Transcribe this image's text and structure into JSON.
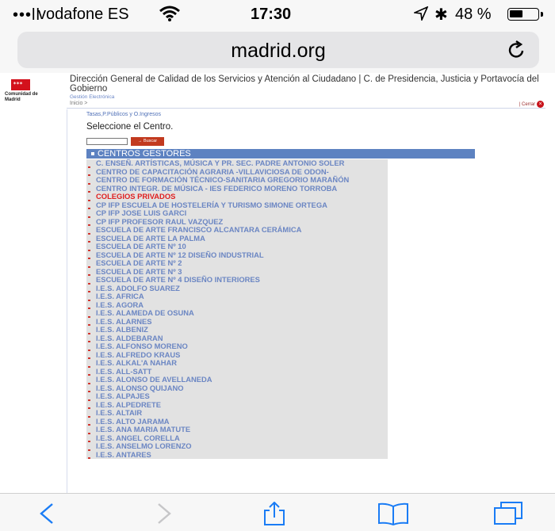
{
  "status": {
    "carrier": "vodafone ES",
    "time": "17:30",
    "battery_percent_text": "48 %",
    "battery_level": 0.48,
    "icons": [
      "signal-icon",
      "wifi-icon",
      "location-icon",
      "bluetooth-icon",
      "battery-icon"
    ]
  },
  "browser": {
    "url": "madrid.org",
    "reload_icon": "reload-icon",
    "toolbar_icons": [
      "back-icon",
      "forward-icon",
      "share-icon",
      "bookmarks-icon",
      "tabs-icon"
    ]
  },
  "gov": {
    "logo_text": "Comunidad de Madrid",
    "direccion": "Dirección General de Calidad de los Servicios y Atención al Ciudadano | C. de Presidencia, Justicia y Portavocía del Gobierno",
    "subtitle": "Gestión Electrónica",
    "inicio": "Inicio >",
    "cerrar": "| Cerrar",
    "brand_color": "#d3111c"
  },
  "page": {
    "breadcrumb": "Tasas,P.Públicos y O.Ingresos",
    "select_title": "Seleccione el Centro.",
    "search_button": "→ Buscar",
    "section_header": "CENTROS GESTORES",
    "items": [
      {
        "label": "C. ENSEÑ. ARTÍSTICAS, MÚSICA Y PR. SEC. PADRE ANTONIO SOLER",
        "red": false
      },
      {
        "label": "CENTRO DE CAPACITACIÓN AGRARIA -VILLAVICIOSA DE ODON-",
        "red": false
      },
      {
        "label": "CENTRO DE FORMACIÓN TÉCNICO-SANITARIA GREGORIO MARAÑÓN",
        "red": false
      },
      {
        "label": "CENTRO INTEGR. DE MÚSICA - IES FEDERICO MORENO TORROBA",
        "red": false
      },
      {
        "label": "COLEGIOS PRIVADOS",
        "red": true
      },
      {
        "label": "CP IFP ESCUELA DE HOSTELERÍA Y TURISMO SIMONE ORTEGA",
        "red": false
      },
      {
        "label": "CP IFP JOSE LUIS GARCI",
        "red": false
      },
      {
        "label": "CP IFP PROFESOR RAUL VAZQUEZ",
        "red": false
      },
      {
        "label": "ESCUELA DE ARTE FRANCISCO ALCANTARA CERÁMICA",
        "red": false
      },
      {
        "label": "ESCUELA DE ARTE LA PALMA",
        "red": false
      },
      {
        "label": "ESCUELA DE ARTE Nº 10",
        "red": false
      },
      {
        "label": "ESCUELA DE ARTE Nº 12 DISEÑO INDUSTRIAL",
        "red": false
      },
      {
        "label": "ESCUELA DE ARTE Nº 2",
        "red": false
      },
      {
        "label": "ESCUELA DE ARTE Nº 3",
        "red": false
      },
      {
        "label": "ESCUELA DE ARTE Nº 4 DISEÑO INTERIORES",
        "red": false
      },
      {
        "label": "I.E.S. ADOLFO SUAREZ",
        "red": false
      },
      {
        "label": "I.E.S. AFRICA",
        "red": false
      },
      {
        "label": "I.E.S. AGORA",
        "red": false
      },
      {
        "label": "I.E.S. ALAMEDA DE OSUNA",
        "red": false
      },
      {
        "label": "I.E.S. ALARNES",
        "red": false
      },
      {
        "label": "I.E.S. ALBENIZ",
        "red": false
      },
      {
        "label": "I.E.S. ALDEBARAN",
        "red": false
      },
      {
        "label": "I.E.S. ALFONSO MORENO",
        "red": false
      },
      {
        "label": "I.E.S. ALFREDO KRAUS",
        "red": false
      },
      {
        "label": "I.E.S. ALKAL'A NAHAR",
        "red": false
      },
      {
        "label": "I.E.S. ALL-SATT",
        "red": false
      },
      {
        "label": "I.E.S. ALONSO DE AVELLANEDA",
        "red": false
      },
      {
        "label": "I.E.S. ALONSO QUIJANO",
        "red": false
      },
      {
        "label": "I.E.S. ALPAJES",
        "red": false
      },
      {
        "label": "I.E.S. ALPEDRETE",
        "red": false
      },
      {
        "label": "I.E.S. ALTAIR",
        "red": false
      },
      {
        "label": "I.E.S. ALTO JARAMA",
        "red": false
      },
      {
        "label": "I.E.S. ANA MARIA MATUTE",
        "red": false
      },
      {
        "label": "I.E.S. ANGEL CORELLA",
        "red": false
      },
      {
        "label": "I.E.S. ANSELMO LORENZO",
        "red": false
      },
      {
        "label": "I.E.S. ANTARES",
        "red": false
      }
    ]
  }
}
